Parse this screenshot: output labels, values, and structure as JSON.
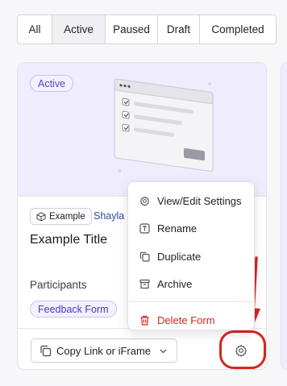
{
  "filters": {
    "tabs": [
      {
        "label": "All"
      },
      {
        "label": "Active"
      },
      {
        "label": "Paused"
      },
      {
        "label": "Draft"
      },
      {
        "label": "Completed"
      }
    ],
    "selected": "Active"
  },
  "card": {
    "status": "Active",
    "example_label": "Example",
    "owner": "Shayla",
    "title": "Example Title",
    "participants_label": "Participants",
    "form_type": "Feedback Form",
    "copy_button_label": "Copy Link or iFrame"
  },
  "menu": {
    "items": [
      {
        "label": "View/Edit Settings",
        "icon": "gear-icon"
      },
      {
        "label": "Rename",
        "icon": "text-box-icon"
      },
      {
        "label": "Duplicate",
        "icon": "copy-icon"
      },
      {
        "label": "Archive",
        "icon": "archive-icon"
      }
    ],
    "danger_item": {
      "label": "Delete Form",
      "icon": "trash-icon"
    }
  },
  "colors": {
    "accent_purple": "#5b3fd6",
    "hero_bg": "#eeecfd",
    "danger": "#d3261f",
    "annotation": "#d9251d"
  }
}
